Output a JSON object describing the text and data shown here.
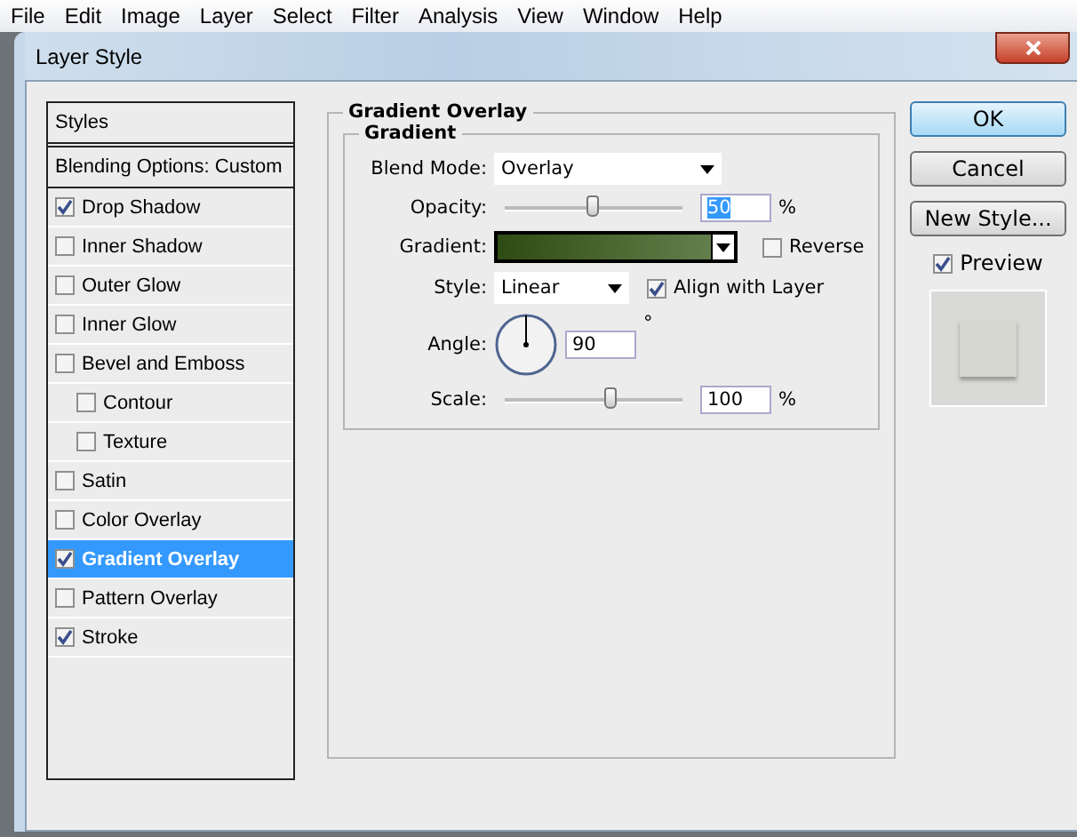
{
  "menu_bar": [
    "File",
    "Edit",
    "Image",
    "Layer",
    "Select",
    "Filter",
    "Analysis",
    "View",
    "Window",
    "Help"
  ],
  "window": {
    "title": "Layer Style"
  },
  "styles_list": [
    {
      "kind": "header",
      "label": "Styles",
      "selected": false
    },
    {
      "kind": "option",
      "label": "Blending Options: Custom",
      "selected": false
    },
    {
      "kind": "effect",
      "label": "Drop Shadow",
      "checked": true,
      "selected": false
    },
    {
      "kind": "effect",
      "label": "Inner Shadow",
      "checked": false,
      "selected": false
    },
    {
      "kind": "effect",
      "label": "Outer Glow",
      "checked": false,
      "selected": false
    },
    {
      "kind": "effect",
      "label": "Inner Glow",
      "checked": false,
      "selected": false
    },
    {
      "kind": "effect",
      "label": "Bevel and Emboss",
      "checked": false,
      "selected": false,
      "children": [
        {
          "kind": "effect",
          "label": "Contour",
          "checked": false,
          "selected": false
        },
        {
          "kind": "effect",
          "label": "Texture",
          "checked": false,
          "selected": false
        }
      ]
    },
    {
      "kind": "effect",
      "label": "Satin",
      "checked": false,
      "selected": false
    },
    {
      "kind": "effect",
      "label": "Color Overlay",
      "checked": false,
      "selected": false
    },
    {
      "kind": "effect",
      "label": "Gradient Overlay",
      "checked": true,
      "selected": true
    },
    {
      "kind": "effect",
      "label": "Pattern Overlay",
      "checked": false,
      "selected": false
    },
    {
      "kind": "effect",
      "label": "Stroke",
      "checked": true,
      "selected": false
    }
  ],
  "panel": {
    "title": "Gradient Overlay",
    "group_title": "Gradient",
    "blend_mode": {
      "label": "Blend Mode:",
      "value": "Overlay"
    },
    "opacity": {
      "label": "Opacity:",
      "level": 0.5,
      "value": "50",
      "unit": "%"
    },
    "gradient": {
      "label": "Gradient:",
      "reverse": {
        "label": "Reverse",
        "checked": false
      }
    },
    "style": {
      "label": "Style:",
      "value": "Linear",
      "align": {
        "label": "Align with Layer",
        "checked": true
      }
    },
    "angle": {
      "label": "Angle:",
      "value": "90",
      "unit": "°"
    },
    "scale": {
      "label": "Scale:",
      "level": 0.6,
      "value": "100",
      "unit": "%"
    }
  },
  "buttons": [
    {
      "label": "OK",
      "default": true
    },
    {
      "label": "Cancel",
      "default": false
    },
    {
      "label": "New Style...",
      "default": false
    }
  ],
  "preview": {
    "label": "Preview",
    "checked": true
  }
}
